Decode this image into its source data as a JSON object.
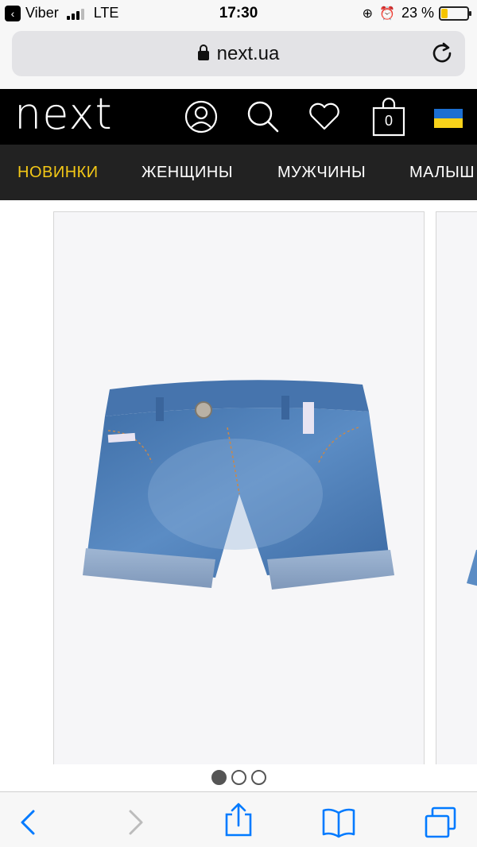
{
  "status_bar": {
    "back_app": "Viber",
    "carrier": "LTE",
    "time": "17:30",
    "battery": "23 %",
    "battery_level": 0.23
  },
  "browser": {
    "url": "next.ua"
  },
  "header": {
    "logo": "next",
    "bag_count": "0"
  },
  "nav": {
    "items": [
      {
        "label": "НОВИНКИ",
        "active": true
      },
      {
        "label": "ЖЕНЩИНЫ",
        "active": false
      },
      {
        "label": "МУЖЧИНЫ",
        "active": false
      },
      {
        "label": "МАЛЫШ",
        "active": false
      }
    ]
  },
  "gallery": {
    "dot_count": 3,
    "active_dot": 1
  },
  "colors": {
    "accent": "#f4c816",
    "ios_blue": "#007aff",
    "header_bg": "#000000",
    "nav_bg": "#222222"
  }
}
